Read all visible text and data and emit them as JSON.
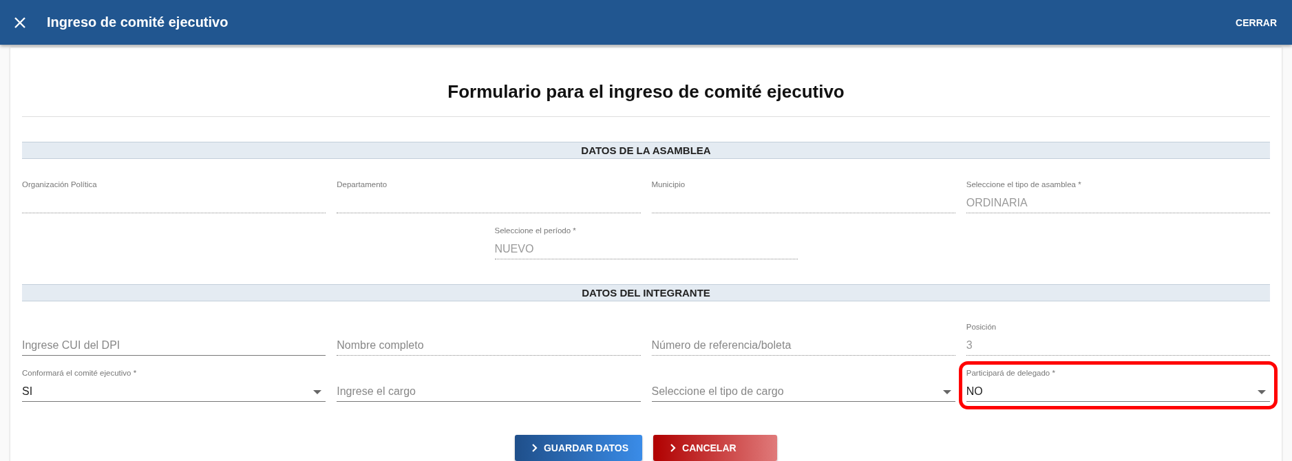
{
  "header": {
    "title": "Ingreso de comité ejecutivo",
    "close_action": "CERRAR"
  },
  "form": {
    "title": "Formulario para el ingreso de comité ejecutivo",
    "sections": [
      {
        "heading": "DATOS DE LA ASAMBLEA",
        "rows": [
          [
            {
              "kind": "text",
              "label": "Organización Política",
              "disabled": true
            },
            {
              "kind": "text",
              "label": "Departamento",
              "disabled": true
            },
            {
              "kind": "text",
              "label": "Municipio",
              "disabled": true
            },
            {
              "kind": "text",
              "label": "Seleccione el tipo de asamblea *",
              "value": "ORDINARIA",
              "disabled": true
            }
          ],
          [
            {
              "kind": "text",
              "label": "Seleccione el período *",
              "value": "NUEVO",
              "disabled": true
            }
          ]
        ]
      },
      {
        "heading": "DATOS DEL INTEGRANTE",
        "rows": [
          [
            {
              "kind": "text",
              "placeholder": "Ingrese CUI del DPI",
              "disabled": false
            },
            {
              "kind": "text",
              "placeholder": "Nombre completo",
              "disabled": true
            },
            {
              "kind": "text",
              "placeholder": "Número de referencia/boleta",
              "disabled": true
            },
            {
              "kind": "text",
              "label": "Posición",
              "value": "3",
              "disabled": true
            }
          ],
          [
            {
              "kind": "select",
              "label": "Conformará el comité ejecutivo *",
              "value": "SI",
              "disabled": false
            },
            {
              "kind": "text",
              "placeholder": "Ingrese el cargo",
              "disabled": false
            },
            {
              "kind": "select",
              "placeholder": "Seleccione el tipo de cargo",
              "disabled": false
            },
            {
              "kind": "select",
              "label": "Participará de delegado *",
              "value": "NO",
              "disabled": false,
              "highlighted": true
            }
          ]
        ]
      }
    ],
    "buttons": [
      {
        "label": "GUARDAR DATOS",
        "kind": "primary"
      },
      {
        "label": "CANCELAR",
        "kind": "danger"
      }
    ]
  }
}
